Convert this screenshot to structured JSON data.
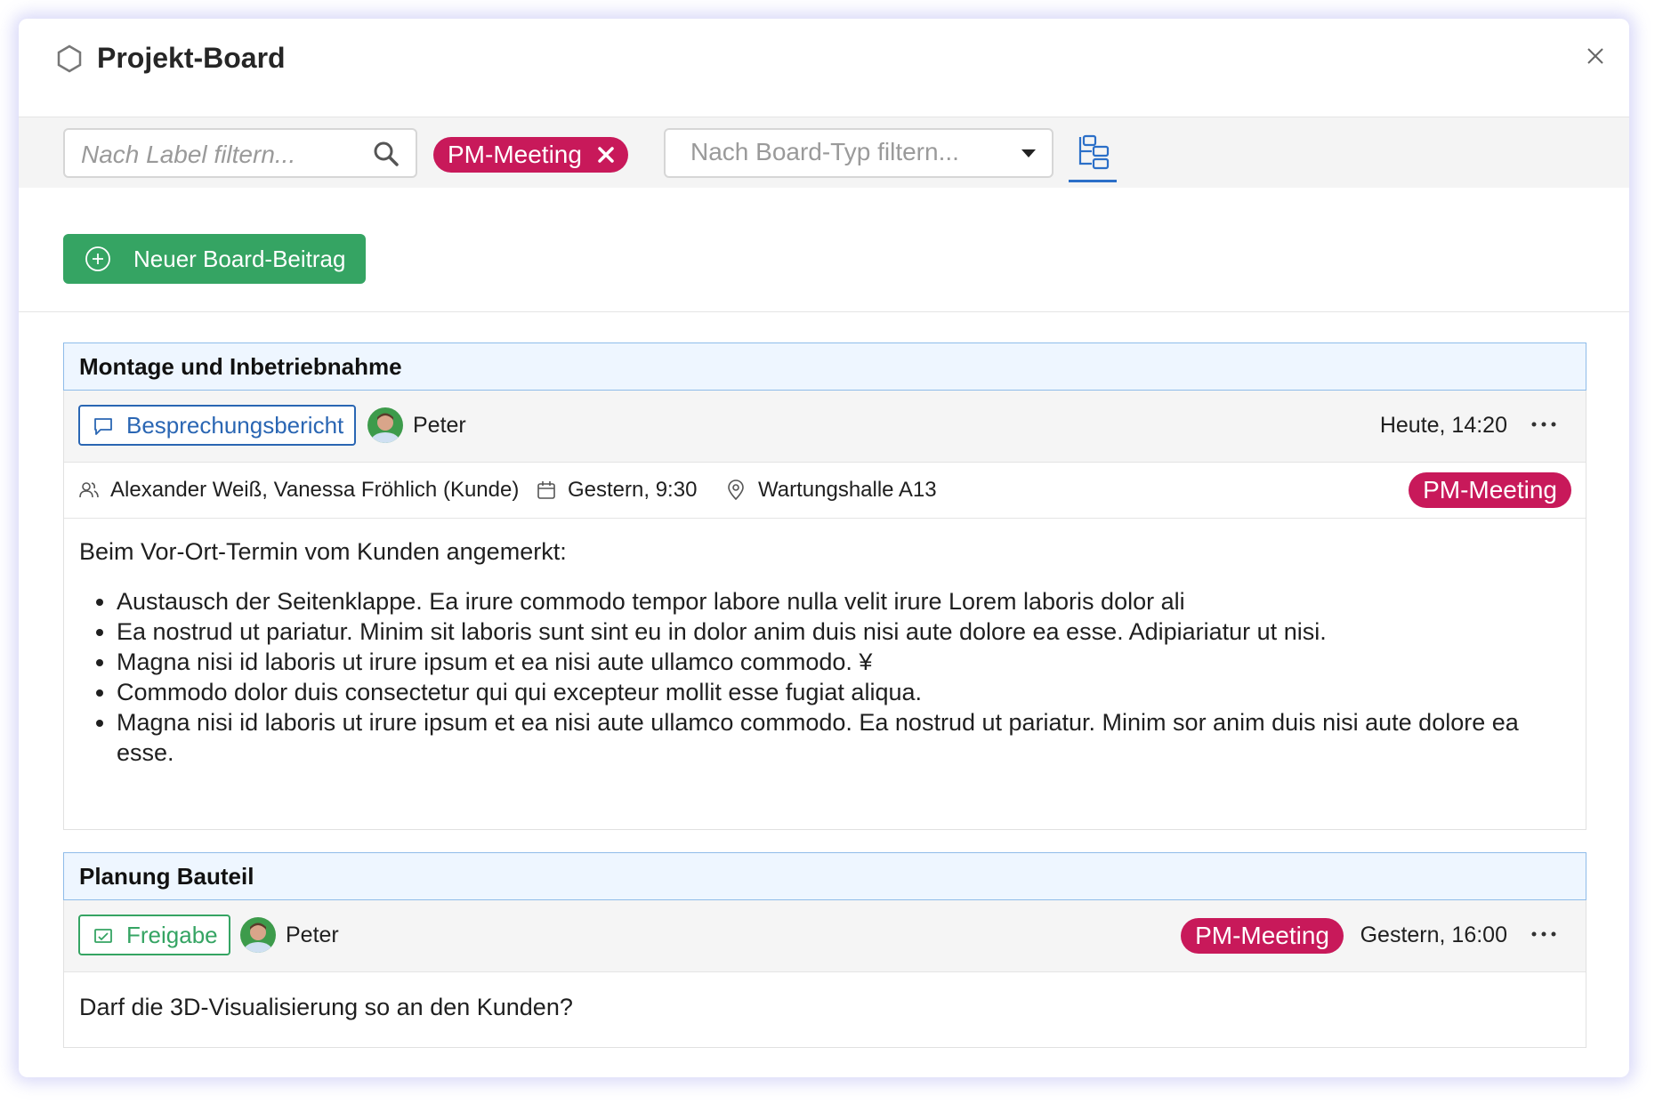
{
  "dialog": {
    "title": "Projekt-Board"
  },
  "filters": {
    "label_placeholder": "Nach Label filtern...",
    "active_chip": "PM-Meeting",
    "board_type_placeholder": "Nach Board-Typ filtern..."
  },
  "actions": {
    "new_entry_label": "Neuer Board-Beitrag"
  },
  "colors": {
    "tag": "#c8195a",
    "primary_green": "#35a463",
    "accent_blue": "#2a66b3"
  },
  "posts": [
    {
      "title": "Montage und Inbetriebnahme",
      "type_label": "Besprechungsbericht",
      "type_icon": "chat-bubble-icon",
      "author": "Peter",
      "timestamp": "Heute, 14:20",
      "participants": "Alexander Weiß, Vanessa Fröhlich (Kunde)",
      "meeting_date": "Gestern, 9:30",
      "location": "Wartungshalle A13",
      "tag": "PM-Meeting",
      "intro": "Beim Vor-Ort-Termin vom Kunden angemerkt:",
      "bullets": [
        "Austausch der Seitenklappe. Ea irure commodo tempor labore nulla velit irure Lorem laboris dolor ali",
        "Ea nostrud ut pariatur. Minim sit laboris sunt sint eu in dolor anim duis nisi aute dolore ea esse. Adipiariatur ut nisi.",
        "Magna nisi id laboris ut irure ipsum et ea nisi aute ullamco commodo. ¥",
        "Commodo dolor duis consectetur qui qui excepteur mollit esse fugiat aliqua.",
        "Magna nisi id laboris ut irure ipsum et ea nisi aute ullamco commodo. Ea nostrud ut pariatur. Minim sor anim duis nisi aute dolore ea esse."
      ]
    },
    {
      "title": "Planung Bauteil",
      "type_label": "Freigabe",
      "type_icon": "approval-icon",
      "author": "Peter",
      "tag": "PM-Meeting",
      "timestamp": "Gestern, 16:00",
      "question": "Darf die 3D-Visualisierung so an den Kunden?"
    }
  ]
}
